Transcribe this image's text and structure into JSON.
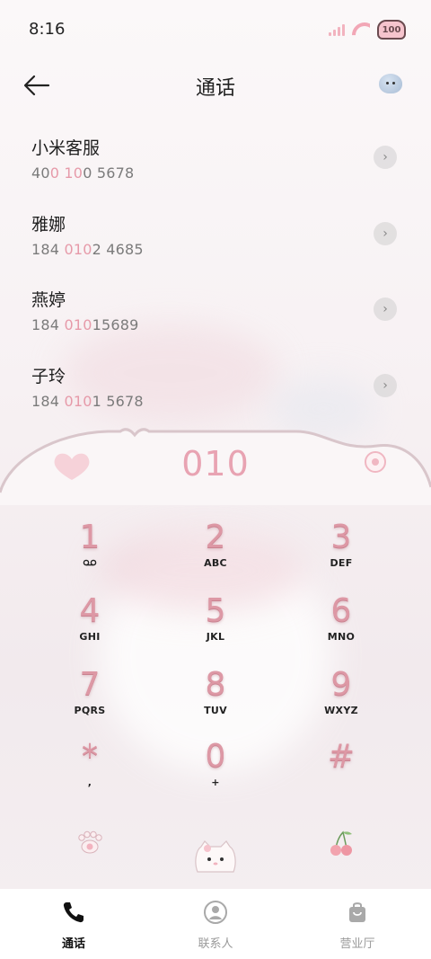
{
  "status_bar": {
    "time": "8:16",
    "battery": "100"
  },
  "header": {
    "title": "通话"
  },
  "calls": [
    {
      "name": "小米客服",
      "parts": [
        "40",
        "0 10",
        "0 5678"
      ]
    },
    {
      "name": "雅娜",
      "parts": [
        "184 ",
        "010",
        "2 4685"
      ]
    },
    {
      "name": "燕婷",
      "parts": [
        "184 ",
        "010",
        "15689"
      ]
    },
    {
      "name": "子玲",
      "parts": [
        "184 ",
        "010",
        "1 5678"
      ]
    }
  ],
  "dialer": {
    "input": "010"
  },
  "keys": [
    {
      "digit": "1",
      "letters": ""
    },
    {
      "digit": "2",
      "letters": "ABC"
    },
    {
      "digit": "3",
      "letters": "DEF"
    },
    {
      "digit": "4",
      "letters": "GHI"
    },
    {
      "digit": "5",
      "letters": "JKL"
    },
    {
      "digit": "6",
      "letters": "MNO"
    },
    {
      "digit": "7",
      "letters": "PQRS"
    },
    {
      "digit": "8",
      "letters": "TUV"
    },
    {
      "digit": "9",
      "letters": "WXYZ"
    },
    {
      "digit": "*",
      "letters": ","
    },
    {
      "digit": "0",
      "letters": "+"
    },
    {
      "digit": "#",
      "letters": ""
    }
  ],
  "nav": {
    "tabs": [
      {
        "label": "通话",
        "icon": "phone-icon",
        "active": true
      },
      {
        "label": "联系人",
        "icon": "contacts-icon",
        "active": false
      },
      {
        "label": "营业厅",
        "icon": "shopping-bag-icon",
        "active": false
      }
    ]
  },
  "colors": {
    "accent_pink": "#e8a3b2",
    "number_highlight": "#e69aa9"
  }
}
